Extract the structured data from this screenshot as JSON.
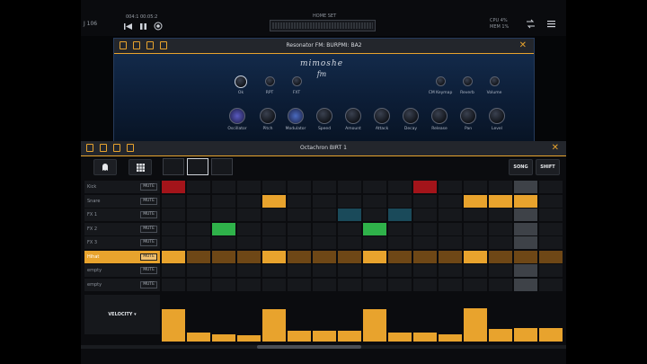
{
  "app": {
    "tempo": "J 106",
    "position": "004:1   00:05:2",
    "lcd_title": "HOME SET",
    "cpu": "CPU 4%",
    "mem": "MEM 1%"
  },
  "synth": {
    "title": "Resonator FM: BURPMI: BA2",
    "brand_line1": "mimoshe",
    "brand_line2": "fm",
    "knobs_top": [
      {
        "label": "Ok"
      },
      {
        "label": "RPT"
      },
      {
        "label": "FXT"
      },
      {
        "label": "CM Keymap"
      },
      {
        "label": "Reverb"
      },
      {
        "label": "Volume"
      }
    ],
    "knobs_bottom": [
      {
        "label": "Oscillator"
      },
      {
        "label": "Pitch"
      },
      {
        "label": "Modulator"
      },
      {
        "label": "Speed"
      },
      {
        "label": "Amount"
      },
      {
        "label": "Attack"
      },
      {
        "label": "Decay"
      },
      {
        "label": "Release"
      },
      {
        "label": "Pan"
      },
      {
        "label": "Level"
      }
    ]
  },
  "drum": {
    "title": "Octachron BIRT 1",
    "buttons": {
      "song": "SONG",
      "shift": "SHIFT"
    },
    "velocity_label": "VELOCITY ▾",
    "rows": [
      {
        "name": "Kick",
        "mute": "MUTE",
        "active": false
      },
      {
        "name": "Snare",
        "mute": "MUTE",
        "active": false
      },
      {
        "name": "FX 1",
        "mute": "MUTE",
        "active": false
      },
      {
        "name": "FX 2",
        "mute": "MUTE",
        "active": false
      },
      {
        "name": "FX 3",
        "mute": "MUTE",
        "active": false
      },
      {
        "name": "Hihat",
        "mute": "MUTE",
        "active": true
      },
      {
        "name": "empty",
        "mute": "MUTE",
        "active": false
      },
      {
        "name": "empty",
        "mute": "MUTE",
        "active": false
      }
    ],
    "colors": {
      "accent": "#e8a32d",
      "red": "#a3141a",
      "teal": "#1a4a5a",
      "green": "#2fb24a",
      "grey": "#3e4248",
      "dark_orange": "#6e4716"
    },
    "grid": [
      [
        0,
        0,
        0,
        0,
        0,
        0,
        0,
        0,
        0,
        0,
        0,
        0,
        0,
        0,
        0,
        0,
        0
      ],
      [
        0,
        0,
        0,
        0,
        0,
        0,
        0,
        0,
        0,
        0,
        0,
        0,
        0,
        0,
        0,
        0,
        0
      ],
      [
        0,
        0,
        0,
        0,
        0,
        0,
        0,
        0,
        0,
        0,
        0,
        0,
        0,
        0,
        0,
        0,
        0
      ],
      [
        0,
        0,
        0,
        0,
        0,
        0,
        0,
        0,
        0,
        0,
        0,
        0,
        0,
        0,
        0,
        0,
        0
      ],
      [
        0,
        0,
        0,
        0,
        0,
        0,
        0,
        0,
        0,
        0,
        0,
        0,
        0,
        0,
        0,
        0,
        0
      ],
      [
        1,
        2,
        2,
        2,
        1,
        2,
        2,
        2,
        1,
        2,
        2,
        2,
        1,
        2,
        2,
        2,
        0
      ],
      [
        0,
        0,
        0,
        0,
        0,
        0,
        0,
        0,
        0,
        0,
        0,
        0,
        0,
        0,
        0,
        0,
        0
      ],
      [
        0,
        0,
        0,
        0,
        0,
        0,
        0,
        0,
        0,
        0,
        0,
        0,
        0,
        0,
        0,
        0,
        0
      ]
    ],
    "velocities": [
      0.78,
      0.22,
      0.18,
      0.16,
      0.78,
      0.26,
      0.26,
      0.26,
      0.78,
      0.22,
      0.22,
      0.18,
      0.8,
      0.3,
      0.32,
      0.32
    ]
  }
}
